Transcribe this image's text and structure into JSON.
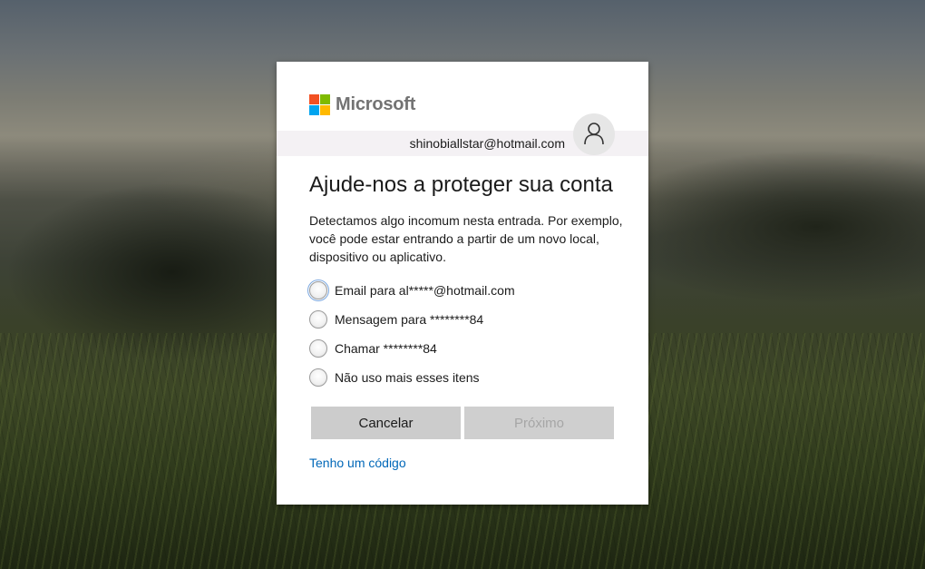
{
  "brand": {
    "name": "Microsoft",
    "squares": [
      "#f25022",
      "#7fba00",
      "#00a4ef",
      "#ffb900"
    ]
  },
  "identity": {
    "email": "shinobiallstar@hotmail.com",
    "avatar_icon": "user-icon"
  },
  "title": "Ajude-nos a proteger sua conta",
  "description": "Detectamos algo incomum nesta entrada. Por exemplo, você pode estar entrando a partir de um novo local, dispositivo ou aplicativo.",
  "options": [
    {
      "label": "Email para al*****@hotmail.com",
      "selected": false,
      "focused": true
    },
    {
      "label": "Mensagem para ********84",
      "selected": false
    },
    {
      "label": "Chamar ********84",
      "selected": false
    },
    {
      "label": "Não uso mais esses itens",
      "selected": false
    }
  ],
  "buttons": {
    "cancel": "Cancelar",
    "next": "Próximo",
    "next_disabled": true
  },
  "link": "Tenho um código",
  "colors": {
    "link": "#0067b8",
    "button": "#cccccc",
    "identity_bar": "#f4f1f4"
  }
}
